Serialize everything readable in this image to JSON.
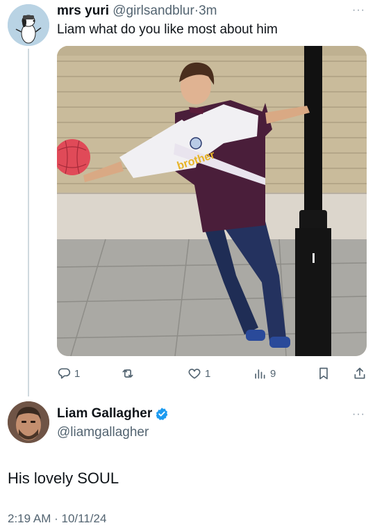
{
  "tweet1": {
    "display_name": "mrs yuri",
    "handle": "@girlsandblur",
    "separator": "·",
    "time": "3m",
    "more": "···",
    "text": "Liam what do you like most about him",
    "image_text": "brother",
    "avatar_icon": "snoopy-avatar",
    "actions": {
      "replies": "1",
      "reposts": "",
      "likes": "1",
      "views": "9"
    }
  },
  "tweet2": {
    "display_name": "Liam Gallagher",
    "handle": "@liamgallagher",
    "more": "···",
    "text": "His lovely SOUL",
    "time": "2:19 AM",
    "separator": "·",
    "date": "10/11/24",
    "verified_color": "#1d9bf0"
  },
  "colors": {
    "text": "#0f1419",
    "secondary": "#536471",
    "thread_line": "#cfd9de"
  }
}
